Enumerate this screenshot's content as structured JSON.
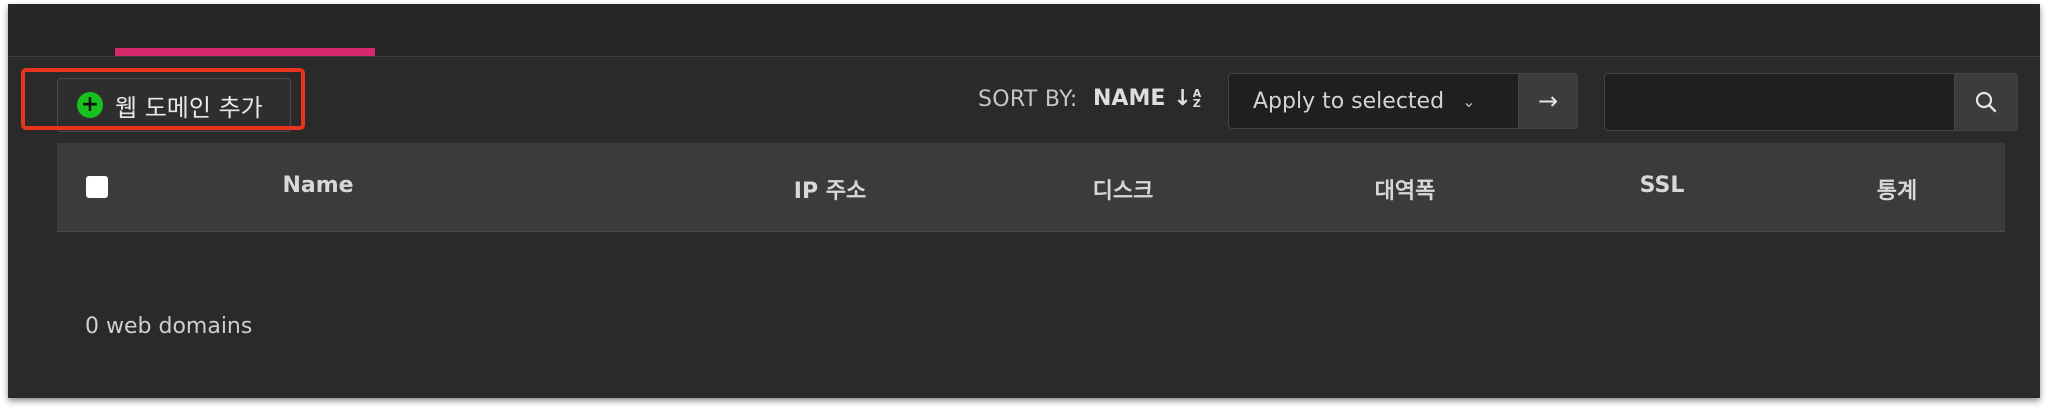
{
  "toolbar": {
    "add_button_label": "웹 도메인 추가",
    "add_icon": "plus-circle-icon",
    "sort_label": "SORT BY:",
    "sort_value": "NAME",
    "sort_icon": "↓",
    "bulk_action": "Apply to selected",
    "apply_icon": "→",
    "search_placeholder": ""
  },
  "table": {
    "columns": [
      "Name",
      "IP 주소",
      "디스크",
      "대역폭",
      "SSL",
      "통계"
    ]
  },
  "footer": {
    "count_text": "0 web domains"
  },
  "colors": {
    "accent": "#d6276a",
    "add_icon": "#18c11d",
    "highlight": "#e8331f"
  }
}
